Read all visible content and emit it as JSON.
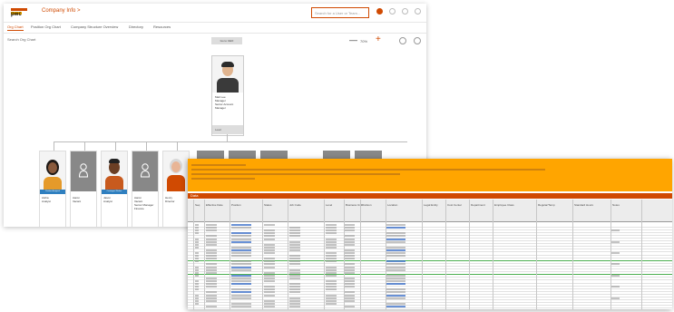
{
  "brand": {
    "logo_text": "pwc",
    "app_title": "Company Info >"
  },
  "header": {
    "search_placeholder": "Search for a User or Team..."
  },
  "tabs": [
    {
      "label": "Org Chart",
      "active": true
    },
    {
      "label": "Position Org Chart",
      "active": false
    },
    {
      "label": "Company Structure Overview",
      "active": false
    },
    {
      "label": "Directory",
      "active": false
    },
    {
      "label": "Resources",
      "active": false
    }
  ],
  "toolbar": {
    "org_search": "Search Org Chart",
    "ceo_button": "Go to CEO",
    "zoom": "70%"
  },
  "ceo": {
    "name": "Matt Lee",
    "title": "Manager",
    "detail": "Senior Account Manager",
    "footer": "Lead"
  },
  "reports": [
    {
      "name": "Aisha",
      "title": "Analyst",
      "badge": "Position Assigned"
    },
    {
      "name": "Aaron",
      "title": "Vacant"
    },
    {
      "name": "Jason",
      "title": "Analyst",
      "badge": "Contingent Worker"
    },
    {
      "name": "Aaron",
      "title": "Vacant",
      "extra": "Senior Manager Finance"
    },
    {
      "name": "Henry",
      "title": "Director"
    }
  ],
  "sheet": {
    "section_label": "Data",
    "headers": [
      "Seq",
      "Effective Date",
      "Position",
      "Status",
      "Job Code",
      "Level",
      "Business Unit",
      "Division",
      "Location",
      "Legal Entity",
      "Cost Center",
      "Department",
      "Employee Class",
      "Regular/Temp",
      "Standard Hours",
      "Notes"
    ]
  },
  "colors": {
    "brand": "#d04a02",
    "banner": "#ffa500",
    "accent_yellow": "#ffb600"
  }
}
